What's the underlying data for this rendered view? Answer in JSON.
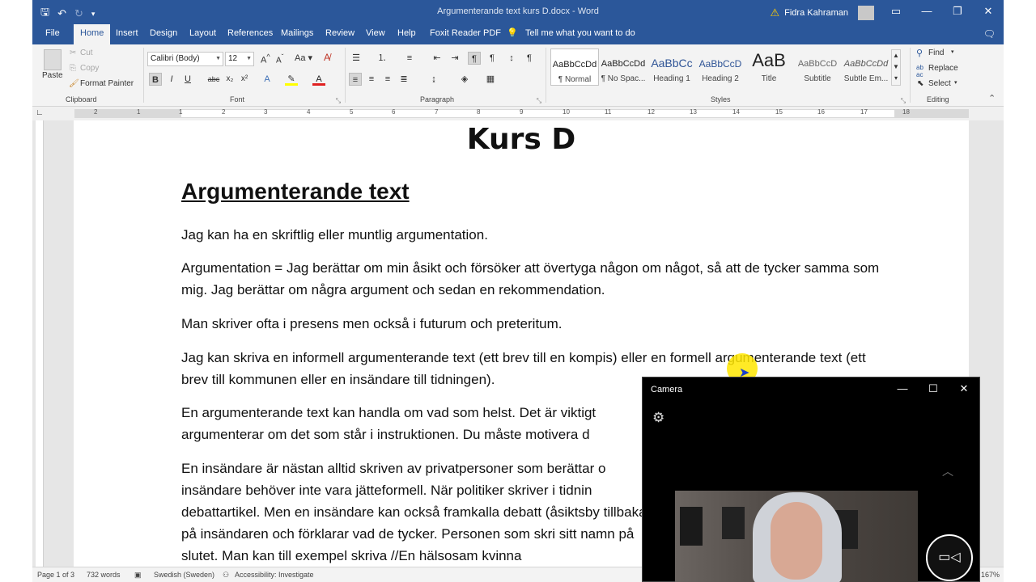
{
  "app": {
    "window_title": "Argumenterande text kurs D.docx - Word",
    "user_name": "Fidra Kahraman"
  },
  "tabs": [
    "File",
    "Home",
    "Insert",
    "Design",
    "Layout",
    "References",
    "Mailings",
    "Review",
    "View",
    "Help",
    "Foxit Reader PDF",
    "Tell me what you want to do"
  ],
  "ribbon": {
    "clipboard": {
      "label": "Clipboard",
      "paste": "Paste",
      "cut": "Cut",
      "copy": "Copy",
      "format_painter": "Format Painter"
    },
    "font": {
      "label": "Font",
      "font_name": "Calibri (Body)",
      "font_size": "12"
    },
    "paragraph": {
      "label": "Paragraph"
    },
    "styles": {
      "label": "Styles",
      "items": [
        {
          "sample": "AaBbCcDd",
          "name": "¶ Normal"
        },
        {
          "sample": "AaBbCcDd",
          "name": "¶ No Spac..."
        },
        {
          "sample": "AaBbCc",
          "name": "Heading 1"
        },
        {
          "sample": "AaBbCcD",
          "name": "Heading 2"
        },
        {
          "sample": "AaB",
          "name": "Title"
        },
        {
          "sample": "AaBbCcD",
          "name": "Subtitle"
        },
        {
          "sample": "AaBbCcDd",
          "name": "Subtle Em..."
        }
      ]
    },
    "editing": {
      "label": "Editing",
      "find": "Find",
      "replace": "Replace",
      "select": "Select"
    }
  },
  "ruler": {
    "labels": [
      "2",
      "1",
      "1",
      "2",
      "3",
      "4",
      "5",
      "6",
      "7",
      "8",
      "9",
      "10",
      "11",
      "12",
      "13",
      "14",
      "15",
      "16",
      "17",
      "18"
    ]
  },
  "document": {
    "title": "Kurs D",
    "heading": "Argumenterande text",
    "paragraphs": [
      "Jag kan ha en skriftlig eller muntlig argumentation.",
      "Argumentation = Jag berättar om min åsikt och försöker att övertyga någon om något, så att de tycker samma som mig. Jag berättar om några argument och sedan en rekommendation.",
      " Man skriver ofta i presens men också i futurum och preteritum.",
      "Jag kan skriva en informell argumenterande text (ett brev till en kompis) eller en formell argumenterande text (ett brev till kommunen eller en insändare till tidningen).",
      "En argumenterande text kan handla om vad som helst. Det är viktigt argumenterar om det som står i instruktionen.  Du måste motivera d",
      "En insändare är nästan alltid skriven av privatpersoner som berättar o insändare behöver inte vara jätteformell. När politiker skriver i tidnin debattartikel. Men en insändare kan också framkalla debatt (åsiktsby tillbaka på insändaren och förklarar vad de tycker. Personen som skri sitt namn på slutet. Man kan till exempel skriva //En hälsosam kvinna"
    ]
  },
  "status": {
    "page": "Page 1 of 3",
    "words": "732 words",
    "language": "Swedish (Sweden)",
    "accessibility": "Accessibility: Investigate",
    "zoom": "167%"
  },
  "camera": {
    "title": "Camera"
  }
}
